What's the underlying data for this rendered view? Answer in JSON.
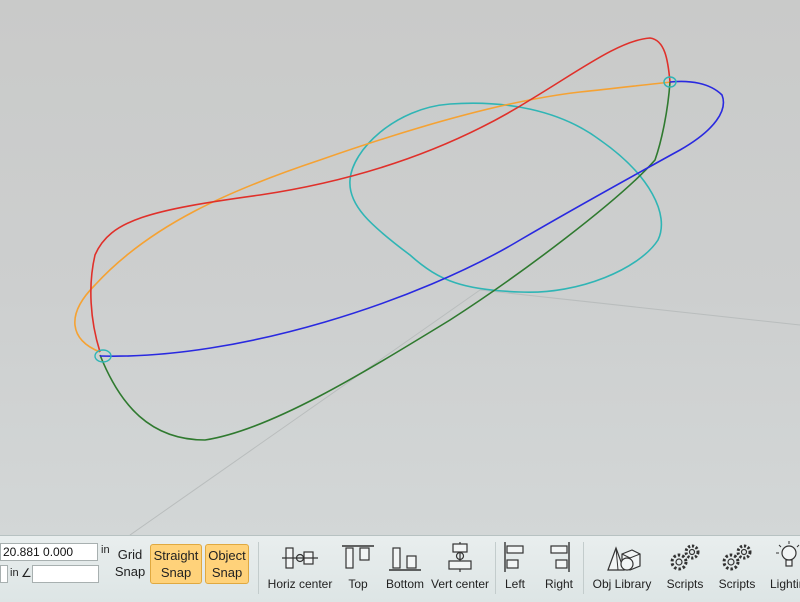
{
  "viewport": {
    "curve_colors": {
      "red": "#e0302a",
      "orange": "#f5a233",
      "blue": "#2929e0",
      "teal": "#2fb5b5",
      "green": "#2f7a2f"
    }
  },
  "toolbar": {
    "coord_value": "20.881  0.000",
    "coord_unit": "in",
    "length_unit": "in",
    "angle_symbol": "∠",
    "length_value": "",
    "angle_value": "",
    "grid_snap": {
      "line1": "Grid",
      "line2": "Snap"
    },
    "straight_snap": {
      "line1": "Straight",
      "line2": "Snap"
    },
    "object_snap": {
      "line1": "Object",
      "line2": "Snap"
    },
    "active_color": "#ffd27a",
    "tools": {
      "horiz_center": "Horiz center",
      "top": "Top",
      "bottom": "Bottom",
      "vert_center": "Vert center",
      "left": "Left",
      "right": "Right",
      "obj_library": "Obj Library",
      "scripts_1": "Scripts",
      "scripts_2": "Scripts",
      "lighting": "Lighting"
    }
  }
}
